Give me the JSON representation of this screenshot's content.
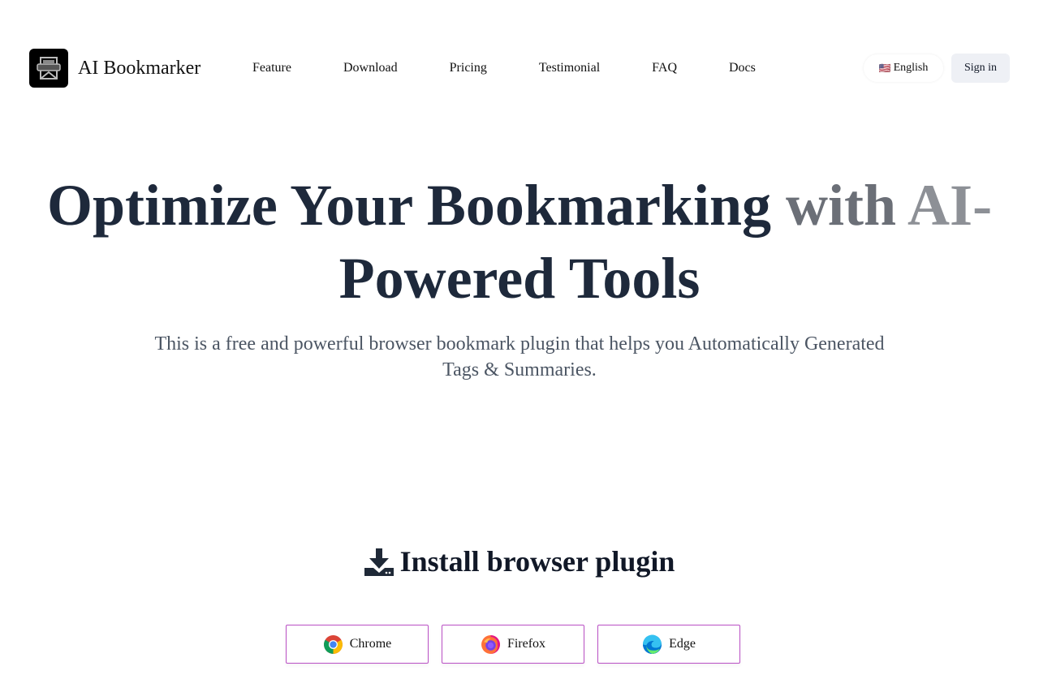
{
  "header": {
    "brand": "AI Bookmarker",
    "nav": [
      "Feature",
      "Download",
      "Pricing",
      "Testimonial",
      "FAQ",
      "Docs"
    ],
    "language": {
      "flag": "🇺🇸",
      "label": "English"
    },
    "signin_label": "Sign in"
  },
  "hero": {
    "title_part1": "Optimize Your Bookmarking ",
    "title_part2": "with ",
    "title_part3": "AI-",
    "title_part4": "Powered Tools",
    "subtitle": "This is a free and powerful browser bookmark plugin that helps you Automatically Generated Tags & Summaries."
  },
  "install": {
    "title": "Install browser plugin",
    "browsers": [
      {
        "label": "Chrome",
        "icon": "chrome-icon"
      },
      {
        "label": "Firefox",
        "icon": "firefox-icon"
      },
      {
        "label": "Edge",
        "icon": "edge-icon"
      }
    ]
  },
  "colors": {
    "border_accent": "#b94fc4",
    "signin_bg": "#eef0f5",
    "title_dark": "#1e293b"
  }
}
